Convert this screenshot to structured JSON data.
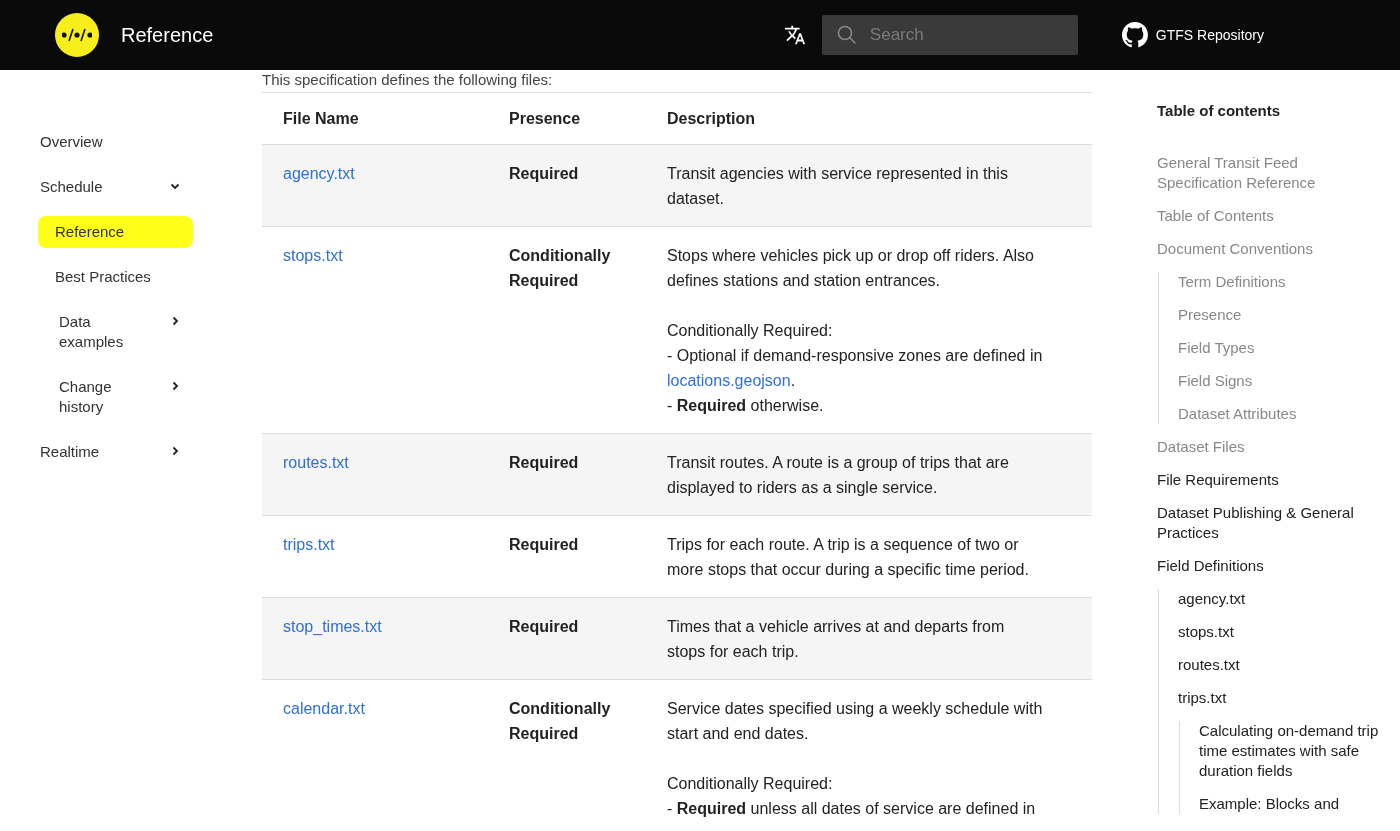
{
  "header": {
    "title": "Reference",
    "search": {
      "placeholder": "Search"
    },
    "repo_link": "GTFS Repository"
  },
  "sidebar": {
    "items": [
      {
        "label": "Overview",
        "kind": "link",
        "selected": false
      },
      {
        "label": "Schedule",
        "kind": "group",
        "expanded": true,
        "selected": false,
        "children": [
          {
            "label": "Reference",
            "kind": "link",
            "selected": true
          },
          {
            "label": "Best Practices",
            "kind": "link",
            "selected": false
          },
          {
            "label": "Data examples",
            "kind": "group",
            "expanded": false,
            "selected": false
          },
          {
            "label": "Change history",
            "kind": "group",
            "expanded": false,
            "selected": false
          }
        ]
      },
      {
        "label": "Realtime",
        "kind": "group",
        "expanded": false,
        "selected": false
      }
    ]
  },
  "intro": "This specification defines the following files:",
  "table": {
    "columns": [
      "File Name",
      "Presence",
      "Description"
    ],
    "rows": [
      {
        "file": "agency.txt",
        "presence": "Required",
        "description": [
          [
            [
              {
                "kind": "text",
                "text": "Transit agencies with service represented in this dataset."
              }
            ]
          ]
        ]
      },
      {
        "file": "stops.txt",
        "presence": "Conditionally Required",
        "description": [
          [
            [
              {
                "kind": "text",
                "text": "Stops where vehicles pick up or drop off riders. Also defines stations and station entrances."
              }
            ]
          ],
          [
            [
              {
                "kind": "text",
                "text": "Conditionally Required:"
              }
            ]
          ],
          [
            [
              {
                "kind": "text",
                "text": "- Optional if demand-responsive zones are defined in "
              },
              {
                "kind": "link",
                "text": "locations.geojson"
              },
              {
                "kind": "text",
                "text": "."
              }
            ]
          ],
          [
            [
              {
                "kind": "text",
                "text": "- **Required** otherwise."
              }
            ]
          ]
        ]
      },
      {
        "file": "routes.txt",
        "presence": "Required",
        "description": [
          [
            [
              {
                "kind": "text",
                "text": "Transit routes. A route is a group of trips that are displayed to riders as a single service."
              }
            ]
          ]
        ]
      },
      {
        "file": "trips.txt",
        "presence": "Required",
        "description": [
          [
            [
              {
                "kind": "text",
                "text": "Trips for each route. A trip is a sequence of two or more stops that occur during a specific time period."
              }
            ]
          ]
        ]
      },
      {
        "file": "stop_times.txt",
        "presence": "Required",
        "description": [
          [
            [
              {
                "kind": "text",
                "text": "Times that a vehicle arrives at and departs from stops for each trip."
              }
            ]
          ]
        ]
      },
      {
        "file": "calendar.txt",
        "presence": "Conditionally Required",
        "description": [
          [
            [
              {
                "kind": "text",
                "text": "Service dates specified using a weekly schedule with start and end dates."
              }
            ]
          ],
          [
            [
              {
                "kind": "text",
                "text": "Conditionally Required:"
              }
            ]
          ],
          [
            [
              {
                "kind": "text",
                "text": "- **Required** unless all dates of service are defined in"
              }
            ]
          ]
        ]
      }
    ]
  },
  "toc": {
    "title": "Table of contents",
    "items": [
      {
        "label": "General Transit Feed Specification Reference",
        "dimmed": true
      },
      {
        "label": "Table of Contents",
        "dimmed": true
      },
      {
        "label": "Document Conventions",
        "dimmed": true,
        "children": [
          {
            "label": "Term Definitions",
            "dimmed": true
          },
          {
            "label": "Presence",
            "dimmed": true
          },
          {
            "label": "Field Types",
            "dimmed": true
          },
          {
            "label": "Field Signs",
            "dimmed": true
          },
          {
            "label": "Dataset Attributes",
            "dimmed": true
          }
        ]
      },
      {
        "label": "Dataset Files",
        "dimmed": true
      },
      {
        "label": "File Requirements",
        "dimmed": false
      },
      {
        "label": "Dataset Publishing & General Practices",
        "dimmed": false
      },
      {
        "label": "Field Definitions",
        "dimmed": false,
        "children": [
          {
            "label": "agency.txt",
            "dimmed": false
          },
          {
            "label": "stops.txt",
            "dimmed": false
          },
          {
            "label": "routes.txt",
            "dimmed": false
          },
          {
            "label": "trips.txt",
            "dimmed": false,
            "children": [
              {
                "label": "Calculating on-demand trip time estimates with safe duration fields",
                "dimmed": false
              },
              {
                "label": "Example: Blocks and",
                "dimmed": false
              }
            ]
          }
        ]
      }
    ]
  }
}
